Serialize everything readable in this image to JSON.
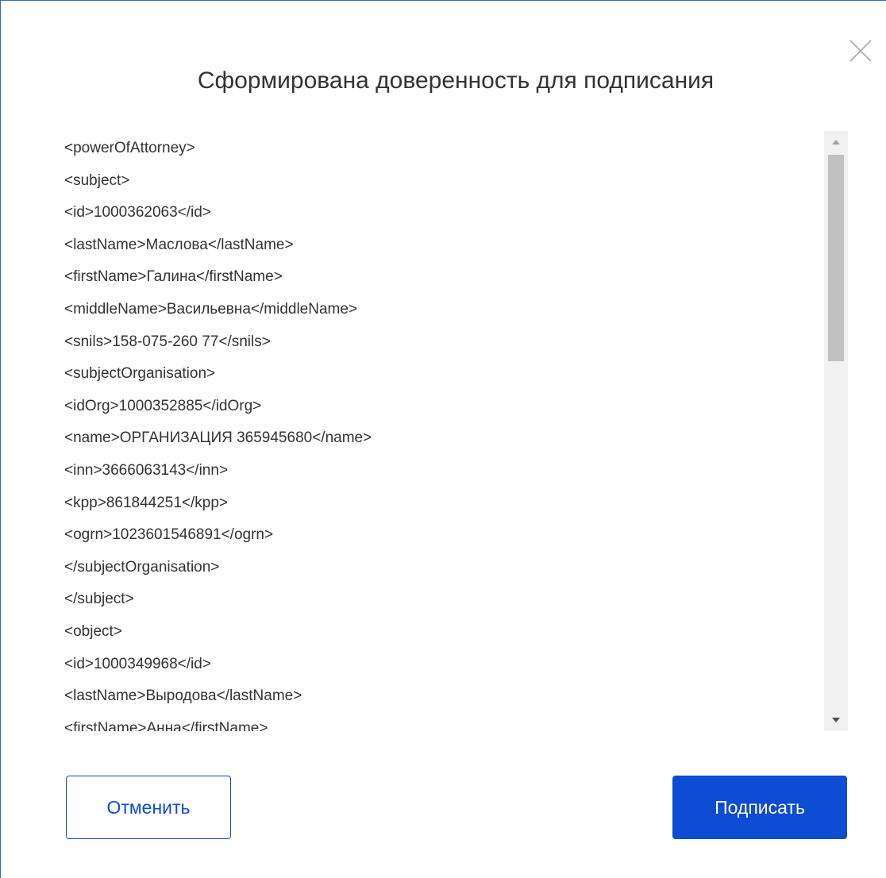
{
  "dialog": {
    "title": "Сформирована доверенность для подписания",
    "close_icon": "close-icon"
  },
  "xml_lines": [
    "<powerOfAttorney>",
    "<subject>",
    "<id>1000362063</id>",
    "<lastName>Маслова</lastName>",
    "<firstName>Галина</firstName>",
    "<middleName>Васильевна</middleName>",
    "<snils>158-075-260 77</snils>",
    "<subjectOrganisation>",
    "<idOrg>1000352885</idOrg>",
    "<name>ОРГАНИЗАЦИЯ 365945680</name>",
    "<inn>3666063143</inn>",
    "<kpp>861844251</kpp>",
    "<ogrn>1023601546891</ogrn>",
    "</subjectOrganisation>",
    "</subject>",
    "<object>",
    "<id>1000349968</id>",
    "<lastName>Выродова</lastName>",
    "<firstName>Анна</firstName>"
  ],
  "buttons": {
    "cancel_label": "Отменить",
    "sign_label": "Подписать"
  },
  "colors": {
    "accent": "#0d4cd3",
    "text": "#333333",
    "border": "#2f6db5"
  }
}
